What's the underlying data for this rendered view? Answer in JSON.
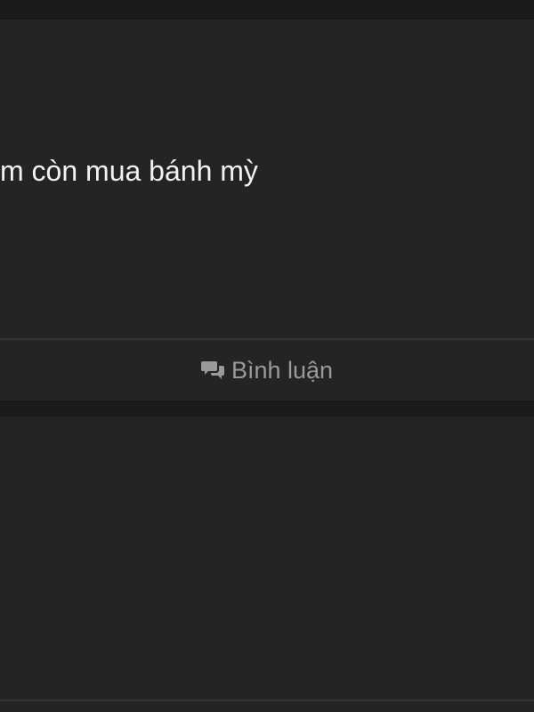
{
  "post": {
    "text": "m còn mua bánh mỳ"
  },
  "actions": {
    "comment_label": "Bình luận",
    "comment_icon": "comment-bubbles-icon"
  },
  "colors": {
    "background": "#1a1a1a",
    "card": "#242424",
    "text": "#f2f2f2",
    "muted": "#9a9a9a",
    "divider": "#333333"
  }
}
